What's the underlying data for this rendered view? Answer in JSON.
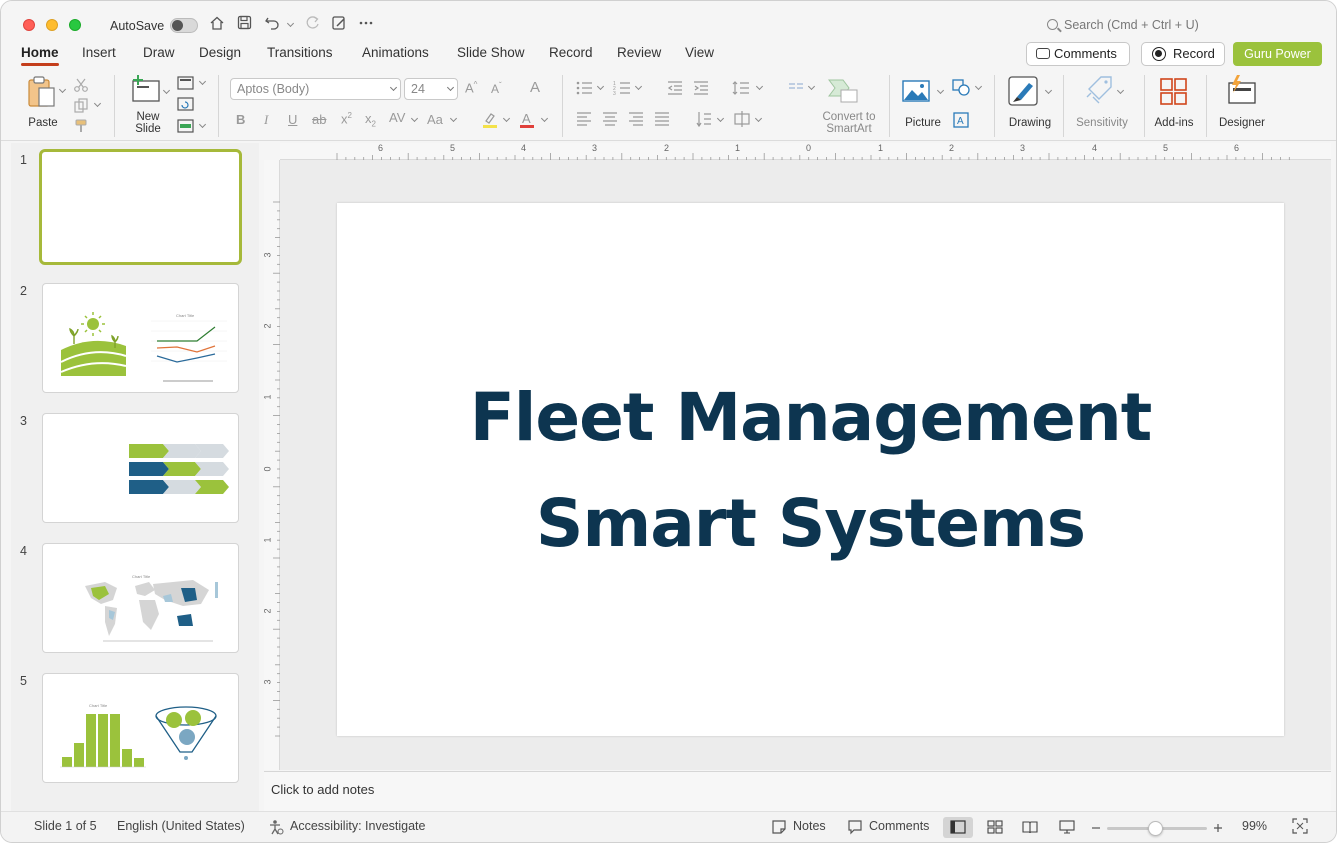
{
  "window": {
    "autosave_label": "AutoSave",
    "search_placeholder": "Search (Cmd + Ctrl + U)"
  },
  "tabs": [
    {
      "label": "Home",
      "active": true
    },
    {
      "label": "Insert"
    },
    {
      "label": "Draw"
    },
    {
      "label": "Design"
    },
    {
      "label": "Transitions"
    },
    {
      "label": "Animations"
    },
    {
      "label": "Slide Show"
    },
    {
      "label": "Record"
    },
    {
      "label": "Review"
    },
    {
      "label": "View"
    }
  ],
  "header_buttons": {
    "comments": "Comments",
    "record": "Record",
    "guru": "Guru Power"
  },
  "ribbon": {
    "paste": "Paste",
    "new_slide_line1": "New",
    "new_slide_line2": "Slide",
    "font_name": "Aptos (Body)",
    "font_size": "24",
    "convert_line1": "Convert to",
    "convert_line2": "SmartArt",
    "picture": "Picture",
    "drawing": "Drawing",
    "sensitivity": "Sensitivity",
    "addins": "Add-ins",
    "designer": "Designer"
  },
  "thumbnails": {
    "numbers": [
      "1",
      "2",
      "3",
      "4",
      "5"
    ],
    "chart_title": "Chart Title"
  },
  "ruler": {
    "h_labels": [
      "6",
      "5",
      "4",
      "3",
      "2",
      "1",
      "0",
      "1",
      "2",
      "3",
      "4",
      "5",
      "6"
    ],
    "v_labels": [
      "3",
      "2",
      "1",
      "0",
      "1",
      "2",
      "3"
    ]
  },
  "slide": {
    "title_line1": "Fleet Management",
    "title_line2": "Smart Systems"
  },
  "notes_placeholder": "Click to add notes",
  "status": {
    "slide_info": "Slide 1 of 5",
    "language": "English (United States)",
    "accessibility": "Accessibility: Investigate",
    "notes": "Notes",
    "comments": "Comments",
    "zoom": "99%"
  },
  "colors": {
    "accent_green": "#9bc23c",
    "title_navy": "#0d3550",
    "tab_underline": "#c43e1c",
    "selected_thumb_border": "#a6b93a"
  }
}
